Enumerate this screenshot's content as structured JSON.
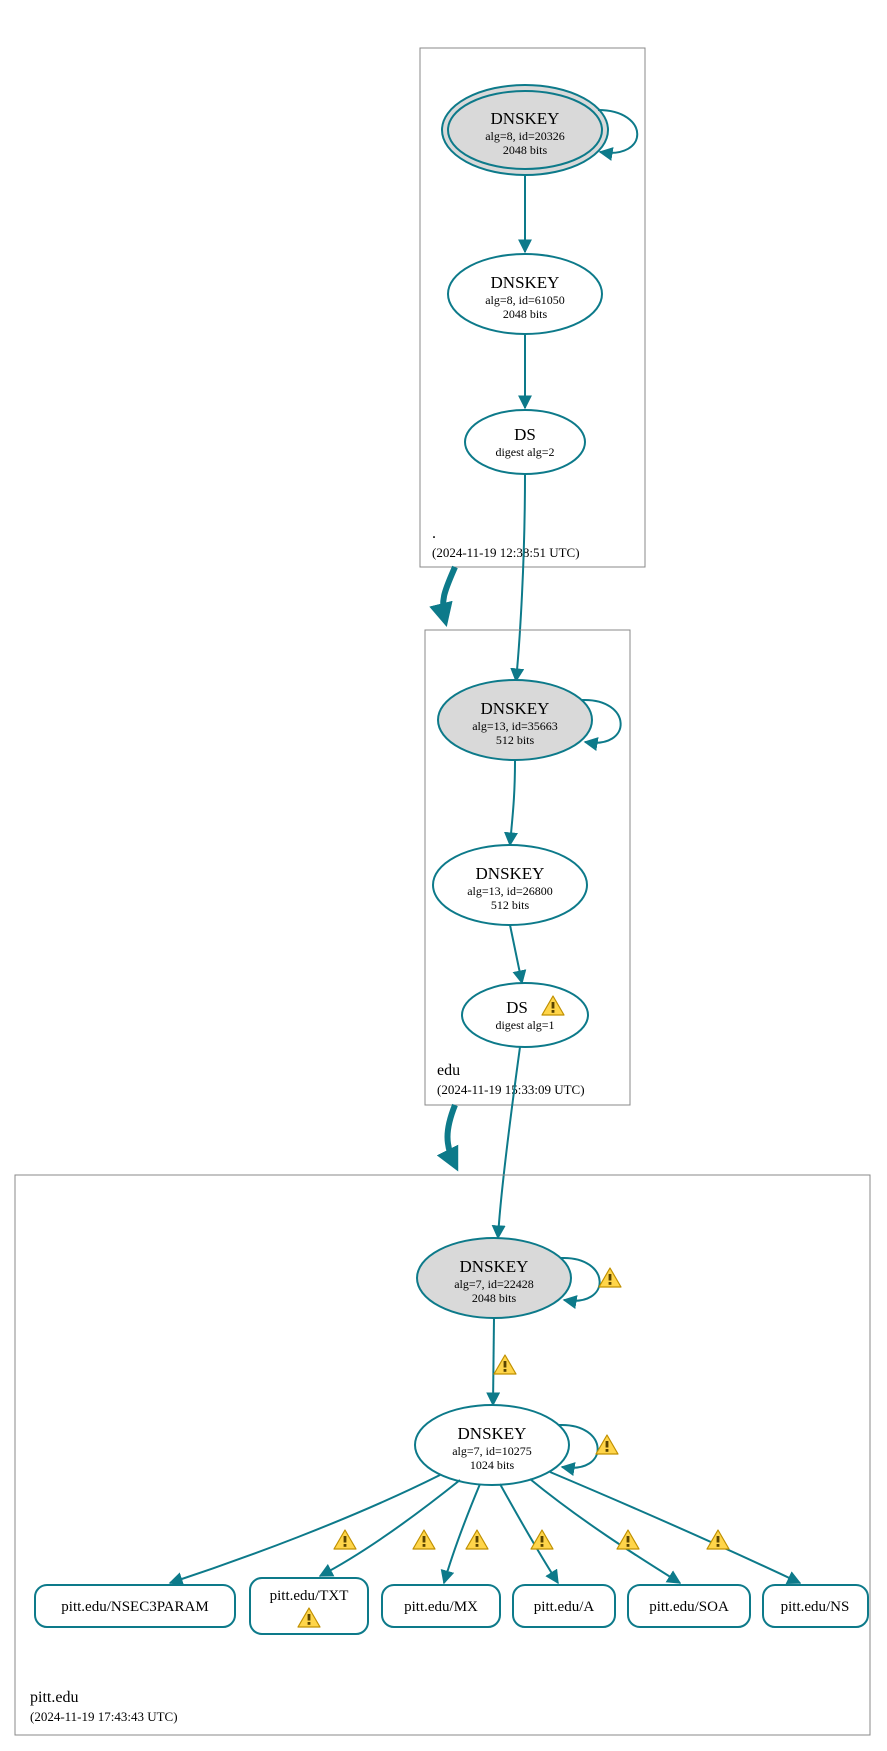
{
  "colors": {
    "stroke": "#0d7a8a",
    "ksk_fill": "#d9d9d9"
  },
  "zones": {
    "root": {
      "name": ".",
      "timestamp": "(2024-11-19 12:38:51 UTC)"
    },
    "edu": {
      "name": "edu",
      "timestamp": "(2024-11-19 15:33:09 UTC)"
    },
    "pitt": {
      "name": "pitt.edu",
      "timestamp": "(2024-11-19 17:43:43 UTC)"
    }
  },
  "nodes": {
    "root_ksk": {
      "title": "DNSKEY",
      "line1": "alg=8, id=20326",
      "line2": "2048 bits"
    },
    "root_zsk": {
      "title": "DNSKEY",
      "line1": "alg=8, id=61050",
      "line2": "2048 bits"
    },
    "root_ds": {
      "title": "DS",
      "line1": "digest alg=2"
    },
    "edu_ksk": {
      "title": "DNSKEY",
      "line1": "alg=13, id=35663",
      "line2": "512 bits"
    },
    "edu_zsk": {
      "title": "DNSKEY",
      "line1": "alg=13, id=26800",
      "line2": "512 bits"
    },
    "edu_ds": {
      "title": "DS",
      "line1": "digest alg=1"
    },
    "pitt_ksk": {
      "title": "DNSKEY",
      "line1": "alg=7, id=22428",
      "line2": "2048 bits"
    },
    "pitt_zsk": {
      "title": "DNSKEY",
      "line1": "alg=7, id=10275",
      "line2": "1024 bits"
    },
    "leaf_nsec3": {
      "label": "pitt.edu/NSEC3PARAM"
    },
    "leaf_txt": {
      "label": "pitt.edu/TXT"
    },
    "leaf_mx": {
      "label": "pitt.edu/MX"
    },
    "leaf_a": {
      "label": "pitt.edu/A"
    },
    "leaf_soa": {
      "label": "pitt.edu/SOA"
    },
    "leaf_ns": {
      "label": "pitt.edu/NS"
    }
  }
}
